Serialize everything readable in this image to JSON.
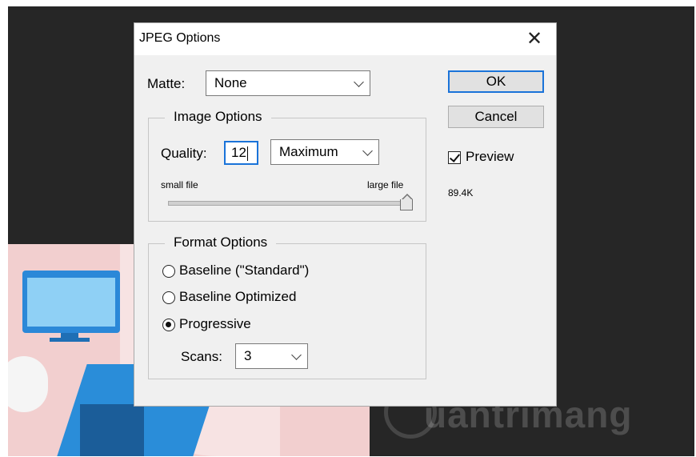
{
  "dialog": {
    "title": "JPEG Options",
    "close_glyph": "✕"
  },
  "matte": {
    "label": "Matte:",
    "value": "None"
  },
  "image_options": {
    "legend": "Image Options",
    "quality_label": "Quality:",
    "quality_value": "12",
    "quality_preset": "Maximum",
    "slider_min_label": "small file",
    "slider_max_label": "large file",
    "slider_fraction": 1.0
  },
  "format_options": {
    "legend": "Format Options",
    "options": [
      {
        "label": "Baseline (\"Standard\")",
        "selected": false
      },
      {
        "label": "Baseline Optimized",
        "selected": false
      },
      {
        "label": "Progressive",
        "selected": true
      }
    ],
    "scans_label": "Scans:",
    "scans_value": "3"
  },
  "buttons": {
    "ok": "OK",
    "cancel": "Cancel"
  },
  "preview": {
    "label": "Preview",
    "checked": true,
    "file_size": "89.4K"
  },
  "watermark": {
    "text": "uantrimang"
  },
  "icons": {
    "close": "close-icon",
    "dropdown": "chevron-down-icon",
    "check": "checkmark-icon"
  },
  "colors": {
    "accent": "#1a73d9",
    "dialog_bg": "#f0f0f0",
    "canvas_bg": "#262626"
  }
}
